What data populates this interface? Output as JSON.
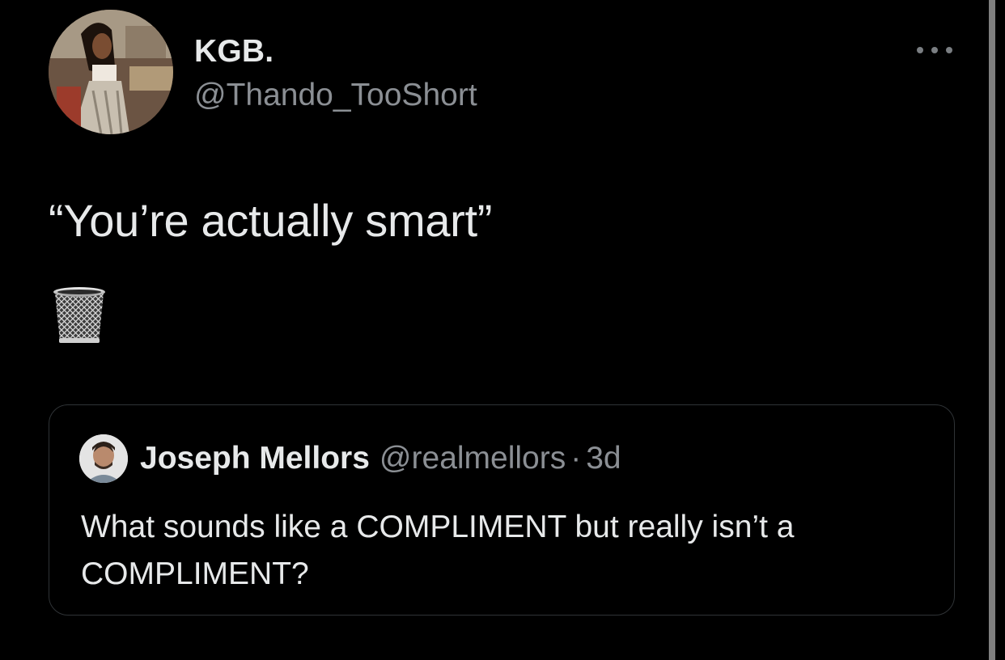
{
  "tweet": {
    "author": {
      "display_name": "KGB.",
      "handle": "@Thando_TooShort"
    },
    "text": "“You’re actually smart”",
    "emoji": "wastebasket-icon",
    "more_icon": "more-dots-icon"
  },
  "quoted_tweet": {
    "author": {
      "display_name": "Joseph Mellors",
      "handle": "@realmellors",
      "separator": "·",
      "time": "3d"
    },
    "text": "What sounds like a COMPLIMENT but really isn’t a COMPLIMENT?"
  },
  "colors": {
    "background": "#000000",
    "primary_text": "#e7e9ea",
    "secondary_text": "#8b8f94",
    "border": "#2f3336"
  }
}
